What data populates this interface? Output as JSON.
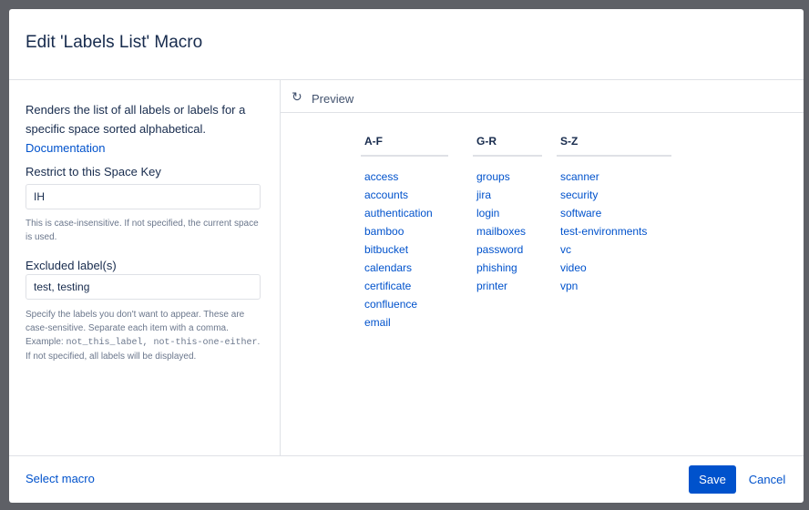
{
  "dialog": {
    "title": "Edit 'Labels List' Macro"
  },
  "left": {
    "description": "Renders the list of all labels or labels for a specific space sorted alphabetical.",
    "documentation_link": "Documentation",
    "space_key": {
      "label": "Restrict to this Space Key",
      "value": "IH",
      "help": "This is case-insensitive. If not specified, the current space is used."
    },
    "excluded": {
      "label": "Excluded label(s)",
      "value": "test, testing",
      "help_intro": "Specify the labels you don't want to appear. These are case-sensitive. Separate each item with a comma. Example:",
      "help_code": "not_this_label, not-this-one-either",
      "help_outro": ". If not specified, all labels will be displayed."
    }
  },
  "preview": {
    "icon": "refresh-icon",
    "label": "Preview",
    "columns": [
      {
        "header": "A-F",
        "items": [
          "access",
          "accounts",
          "authentication",
          "bamboo",
          "bitbucket",
          "calendars",
          "certificate",
          "confluence",
          "email"
        ]
      },
      {
        "header": "G-R",
        "items": [
          "groups",
          "jira",
          "login",
          "mailboxes",
          "password",
          "phishing",
          "printer"
        ]
      },
      {
        "header": "S-Z",
        "items": [
          "scanner",
          "security",
          "software",
          "test-environments",
          "vc",
          "video",
          "vpn"
        ]
      }
    ]
  },
  "footer": {
    "select_macro": "Select macro",
    "save": "Save",
    "cancel": "Cancel"
  },
  "colors": {
    "primary": "#0052cc",
    "text": "#172b4d",
    "muted": "#6b778c",
    "border": "#dfe1e6",
    "overlay": "#5e6066"
  }
}
